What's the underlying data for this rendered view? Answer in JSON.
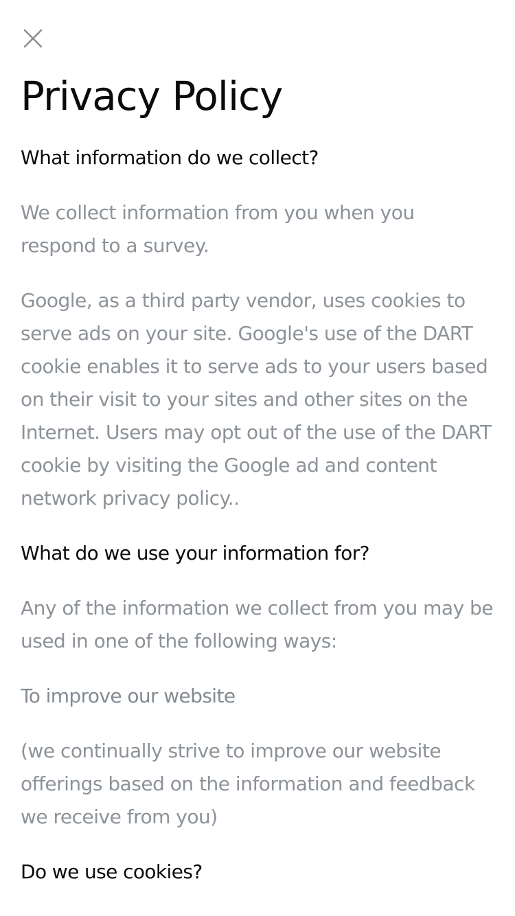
{
  "close_icon": "close-icon",
  "title": "Privacy Policy",
  "sections": {
    "collect": {
      "heading": "What information do we collect?",
      "p1": "We collect information from you when you respond to a survey.",
      "p2": "Google, as a third party vendor, uses cookies to serve ads on your site. Google's use of the DART cookie enables it to serve ads to your users based on their visit to your sites and other sites on the Internet. Users may opt out of the use of the DART cookie by visiting the Google ad and content network privacy policy.."
    },
    "use": {
      "heading": "What do we use your information for?",
      "p1": "Any of the information we collect from you may be used in one of the following ways:",
      "subheading": "To improve our website",
      "p2": "(we continually strive to improve our website offerings based on the information and feedback we receive from you)"
    },
    "cookies": {
      "heading": "Do we use cookies?"
    }
  },
  "colors": {
    "heading": "#0b0b0b",
    "body_text": "#8c9298",
    "close_icon": "#8a8f95"
  }
}
